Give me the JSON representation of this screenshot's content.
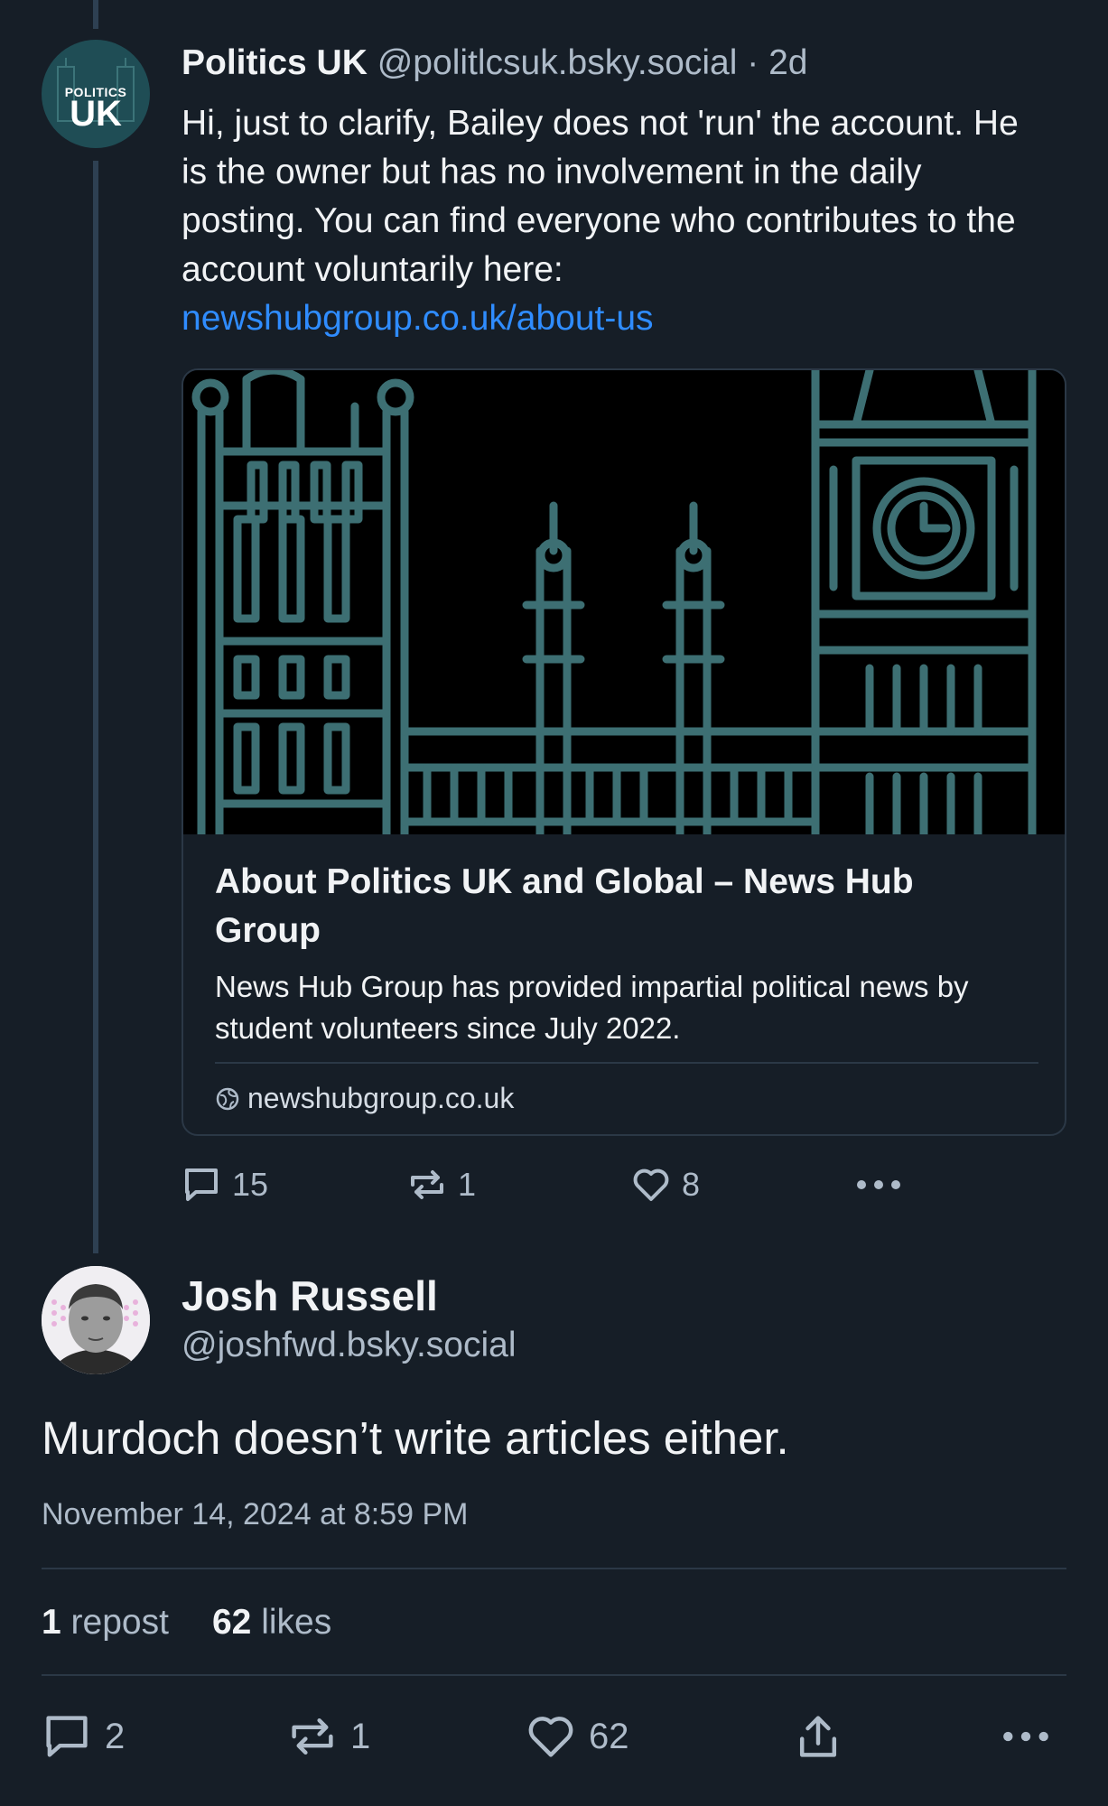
{
  "parent_post": {
    "author_name": "Politics UK",
    "handle": "@politlcsuk.bsky.social",
    "separator": "·",
    "time": "2d",
    "avatar": {
      "small_text": "POLITICS",
      "big_text": "UK"
    },
    "text": "Hi, just to clarify, Bailey does not 'run' the account. He is the owner but has no involvement in the daily posting. You can find everyone who contributes to the account voluntarily here:",
    "link_text": "newshubgroup.co.uk/about-us",
    "card": {
      "title": "About Politics UK and Global – News Hub Group",
      "description": "News Hub Group has provided impartial political news by student volunteers since July 2022.",
      "domain": "newshubgroup.co.uk",
      "domain_icon": "globe-icon"
    },
    "counts": {
      "replies": "15",
      "reposts": "1",
      "likes": "8"
    }
  },
  "focus_post": {
    "author_name": "Josh Russell",
    "handle": "@joshfwd.bsky.social",
    "text": "Murdoch doesn’t write articles either.",
    "timestamp": "November 14, 2024 at 8:59 PM",
    "stats": {
      "reposts_count": "1",
      "reposts_label": "repost",
      "likes_count": "62",
      "likes_label": "likes"
    },
    "counts": {
      "replies": "2",
      "reposts": "1",
      "likes": "62"
    }
  },
  "colors": {
    "background": "#161e27",
    "thread_line": "#2e4052",
    "link": "#2f8cff",
    "muted_text": "#aebbc9",
    "illustration_stroke": "#3d6f73"
  },
  "icons": [
    "reply-icon",
    "repost-icon",
    "like-icon",
    "more-icon",
    "share-icon",
    "globe-icon"
  ]
}
